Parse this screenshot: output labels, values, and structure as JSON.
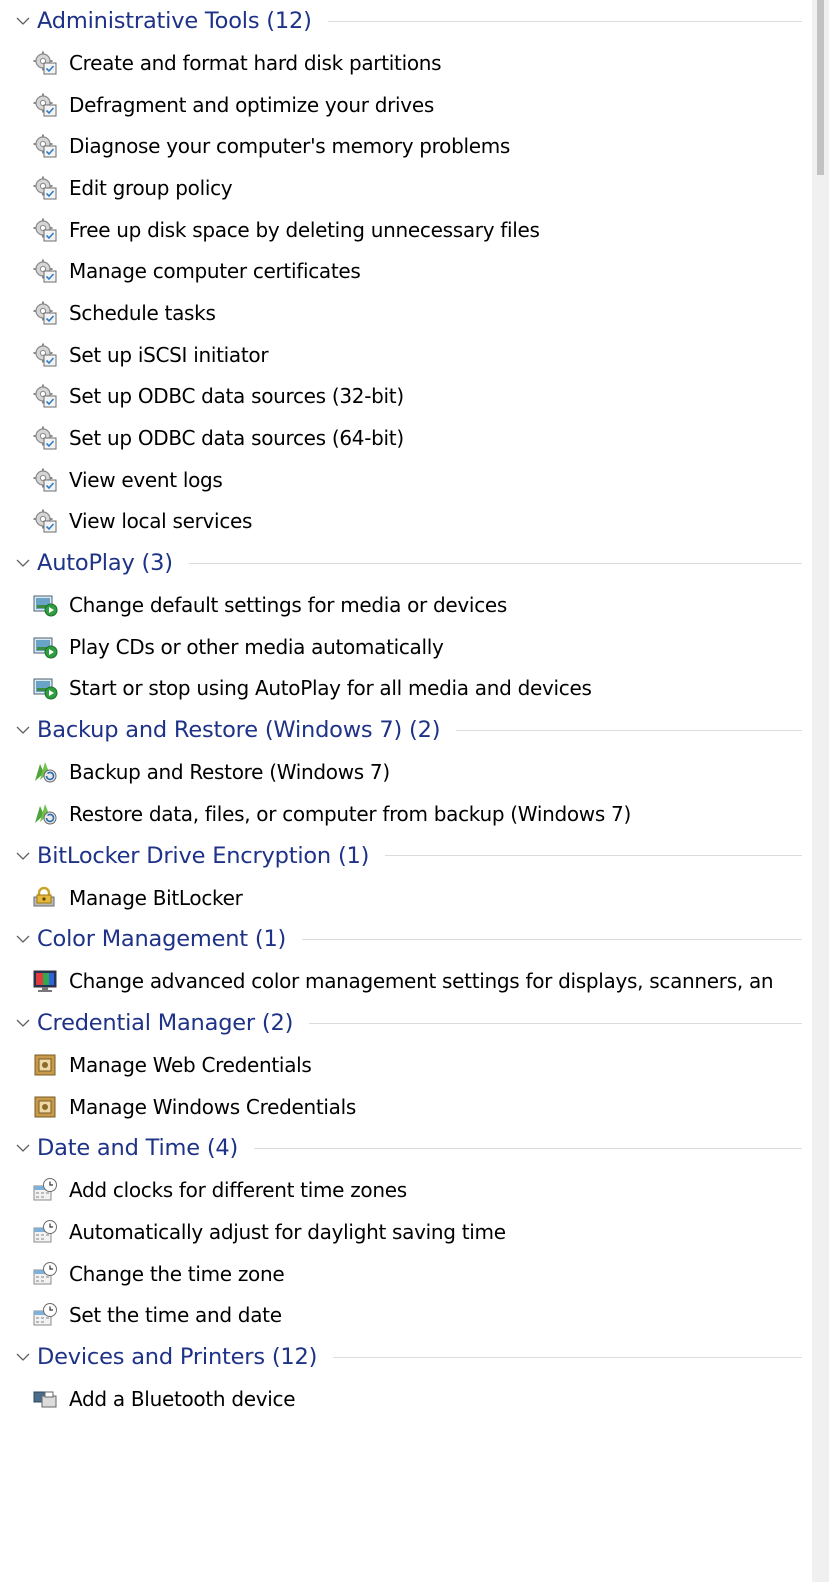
{
  "groups": [
    {
      "title": "Administrative Tools (12)",
      "icon": "admin-tools-icon",
      "items": [
        "Create and format hard disk partitions",
        "Defragment and optimize your drives",
        "Diagnose your computer's memory problems",
        "Edit group policy",
        "Free up disk space by deleting unnecessary files",
        "Manage computer certificates",
        "Schedule tasks",
        "Set up iSCSI initiator",
        "Set up ODBC data sources (32-bit)",
        "Set up ODBC data sources (64-bit)",
        "View event logs",
        "View local services"
      ]
    },
    {
      "title": "AutoPlay (3)",
      "icon": "autoplay-icon",
      "items": [
        "Change default settings for media or devices",
        "Play CDs or other media automatically",
        "Start or stop using AutoPlay for all media and devices"
      ]
    },
    {
      "title": "Backup and Restore (Windows 7) (2)",
      "icon": "backup-restore-icon",
      "items": [
        "Backup and Restore (Windows 7)",
        "Restore data, files, or computer from backup (Windows 7)"
      ]
    },
    {
      "title": "BitLocker Drive Encryption (1)",
      "icon": "bitlocker-icon",
      "items": [
        "Manage BitLocker"
      ]
    },
    {
      "title": "Color Management (1)",
      "icon": "color-management-icon",
      "items": [
        "Change advanced color management settings for displays, scanners, an"
      ]
    },
    {
      "title": "Credential Manager (2)",
      "icon": "credential-manager-icon",
      "items": [
        "Manage Web Credentials",
        "Manage Windows Credentials"
      ]
    },
    {
      "title": "Date and Time (4)",
      "icon": "date-time-icon",
      "items": [
        "Add clocks for different time zones",
        "Automatically adjust for daylight saving time",
        "Change the time zone",
        "Set the time and date"
      ]
    },
    {
      "title": "Devices and Printers (12)",
      "icon": "devices-printers-icon",
      "items": [
        "Add a Bluetooth device"
      ]
    }
  ],
  "colors": {
    "header_text": "#1e3287",
    "item_text": "#000000",
    "rule": "#dcdcdc"
  }
}
